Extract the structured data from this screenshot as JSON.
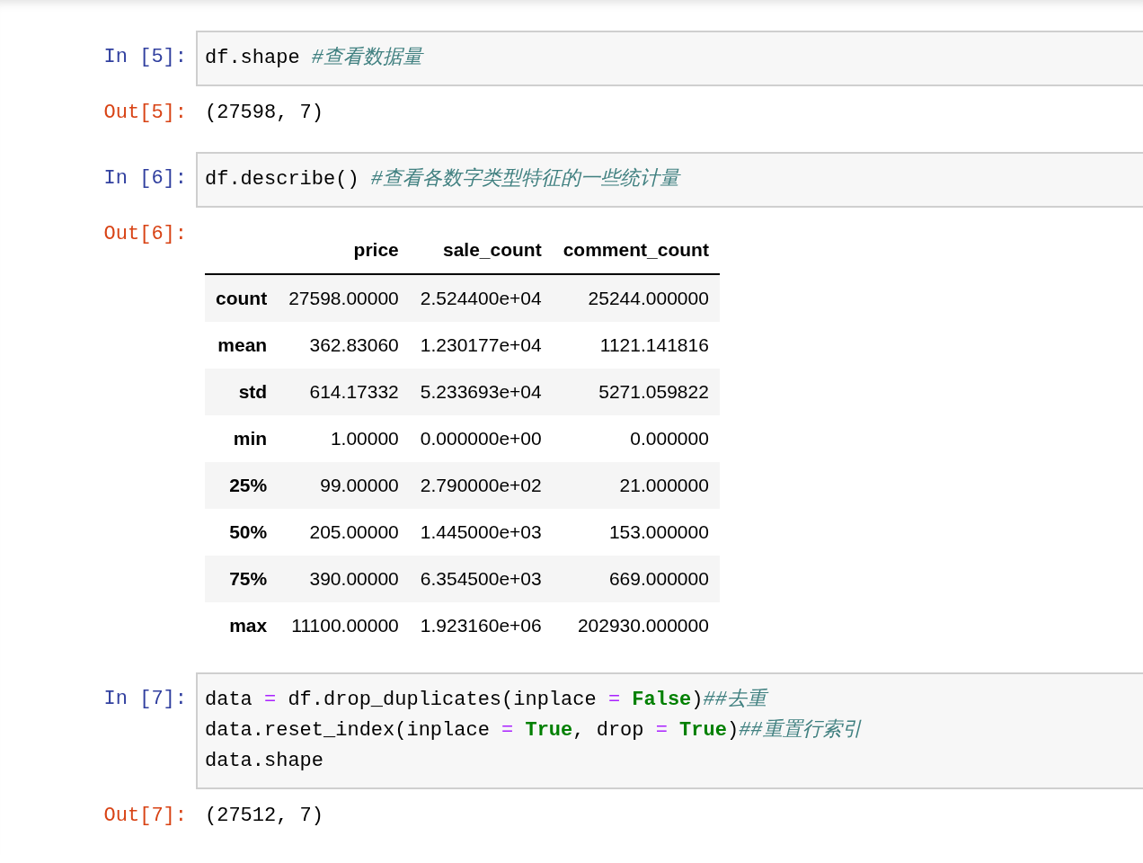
{
  "cells": [
    {
      "in_prompt": "In [5]:",
      "code": [
        [
          {
            "kind": "plain",
            "text": "df.shape "
          },
          {
            "kind": "comment",
            "text": "#查看数据量"
          }
        ]
      ],
      "out_prompt": "Out[5]:",
      "output": {
        "kind": "text",
        "text": "(27598, 7)"
      }
    },
    {
      "in_prompt": "In [6]:",
      "code": [
        [
          {
            "kind": "plain",
            "text": "df.describe() "
          },
          {
            "kind": "comment",
            "text": "#查看各数字类型特征的一些统计量"
          }
        ]
      ],
      "out_prompt": "Out[6]:",
      "output": {
        "kind": "table",
        "columns": [
          "price",
          "sale_count",
          "comment_count"
        ],
        "rows": [
          {
            "index": "count",
            "cells": [
              "27598.00000",
              "2.524400e+04",
              "25244.000000"
            ]
          },
          {
            "index": "mean",
            "cells": [
              "362.83060",
              "1.230177e+04",
              "1121.141816"
            ]
          },
          {
            "index": "std",
            "cells": [
              "614.17332",
              "5.233693e+04",
              "5271.059822"
            ]
          },
          {
            "index": "min",
            "cells": [
              "1.00000",
              "0.000000e+00",
              "0.000000"
            ]
          },
          {
            "index": "25%",
            "cells": [
              "99.00000",
              "2.790000e+02",
              "21.000000"
            ]
          },
          {
            "index": "50%",
            "cells": [
              "205.00000",
              "1.445000e+03",
              "153.000000"
            ]
          },
          {
            "index": "75%",
            "cells": [
              "390.00000",
              "6.354500e+03",
              "669.000000"
            ]
          },
          {
            "index": "max",
            "cells": [
              "11100.00000",
              "1.923160e+06",
              "202930.000000"
            ]
          }
        ]
      }
    },
    {
      "in_prompt": "In [7]:",
      "code": [
        [
          {
            "kind": "plain",
            "text": "data "
          },
          {
            "kind": "op",
            "text": "="
          },
          {
            "kind": "plain",
            "text": " df.drop_duplicates(inplace "
          },
          {
            "kind": "op",
            "text": "= "
          },
          {
            "kind": "keyword",
            "text": "False"
          },
          {
            "kind": "plain",
            "text": ")"
          },
          {
            "kind": "comment",
            "text": "##去重"
          }
        ],
        [
          {
            "kind": "plain",
            "text": "data.reset_index(inplace "
          },
          {
            "kind": "op",
            "text": "= "
          },
          {
            "kind": "keyword",
            "text": "True"
          },
          {
            "kind": "plain",
            "text": ", drop "
          },
          {
            "kind": "op",
            "text": "= "
          },
          {
            "kind": "keyword",
            "text": "True"
          },
          {
            "kind": "plain",
            "text": ")"
          },
          {
            "kind": "comment",
            "text": "##重置行索引"
          }
        ],
        [
          {
            "kind": "plain",
            "text": "data.shape"
          }
        ]
      ],
      "out_prompt": "Out[7]:",
      "output": {
        "kind": "text",
        "text": "(27512, 7)"
      }
    }
  ]
}
